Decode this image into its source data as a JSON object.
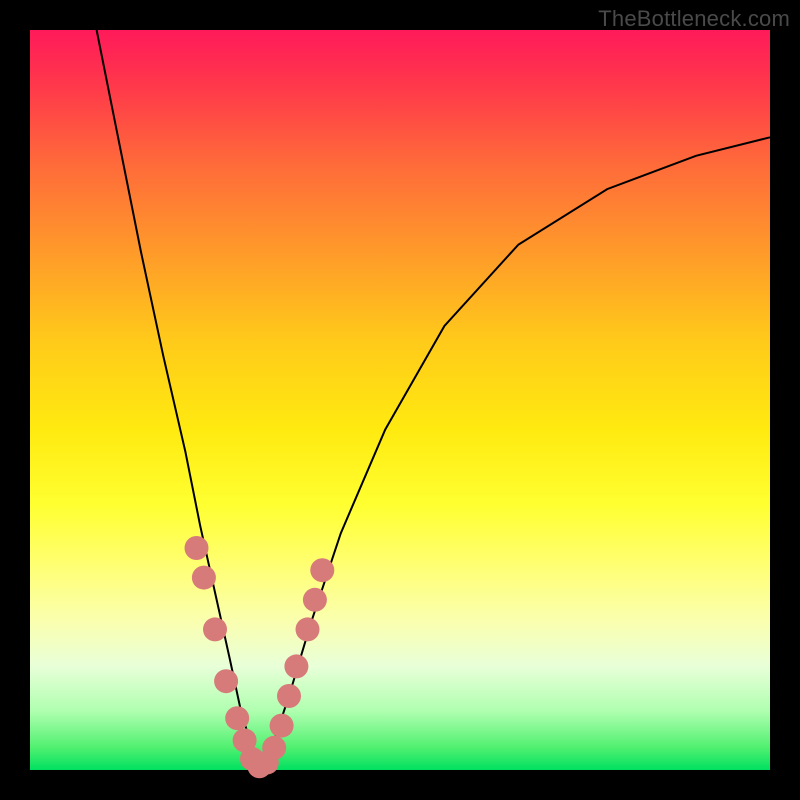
{
  "watermark": "TheBottleneck.com",
  "chart_data": {
    "type": "line",
    "title": "",
    "xlabel": "",
    "ylabel": "",
    "xlim": [
      0,
      100
    ],
    "ylim": [
      0,
      100
    ],
    "grid": false,
    "series": [
      {
        "name": "left-branch",
        "x": [
          9,
          12,
          15,
          18,
          21,
          23,
          25,
          27,
          28.5,
          30,
          31
        ],
        "y": [
          100,
          85,
          70,
          56,
          43,
          33,
          24,
          15,
          8,
          3,
          0
        ],
        "stroke": "#000000",
        "width": 2
      },
      {
        "name": "right-branch",
        "x": [
          31,
          33,
          35,
          38,
          42,
          48,
          56,
          66,
          78,
          90,
          100
        ],
        "y": [
          0,
          4,
          10,
          20,
          32,
          46,
          60,
          71,
          78.5,
          83,
          85.5
        ],
        "stroke": "#000000",
        "width": 2
      }
    ],
    "markers": [
      {
        "name": "highlight-dots",
        "x": [
          22.5,
          23.5,
          25.0,
          26.5,
          28.0,
          29.0,
          30.0,
          31.0,
          32.0,
          33.0,
          34.0,
          35.0,
          36.0,
          37.5,
          38.5,
          39.5
        ],
        "y": [
          30.0,
          26.0,
          19.0,
          12.0,
          7.0,
          4.0,
          1.5,
          0.5,
          1.0,
          3.0,
          6.0,
          10.0,
          14.0,
          19.0,
          23.0,
          27.0
        ],
        "color": "#D77A7A",
        "radius": 12
      }
    ]
  }
}
